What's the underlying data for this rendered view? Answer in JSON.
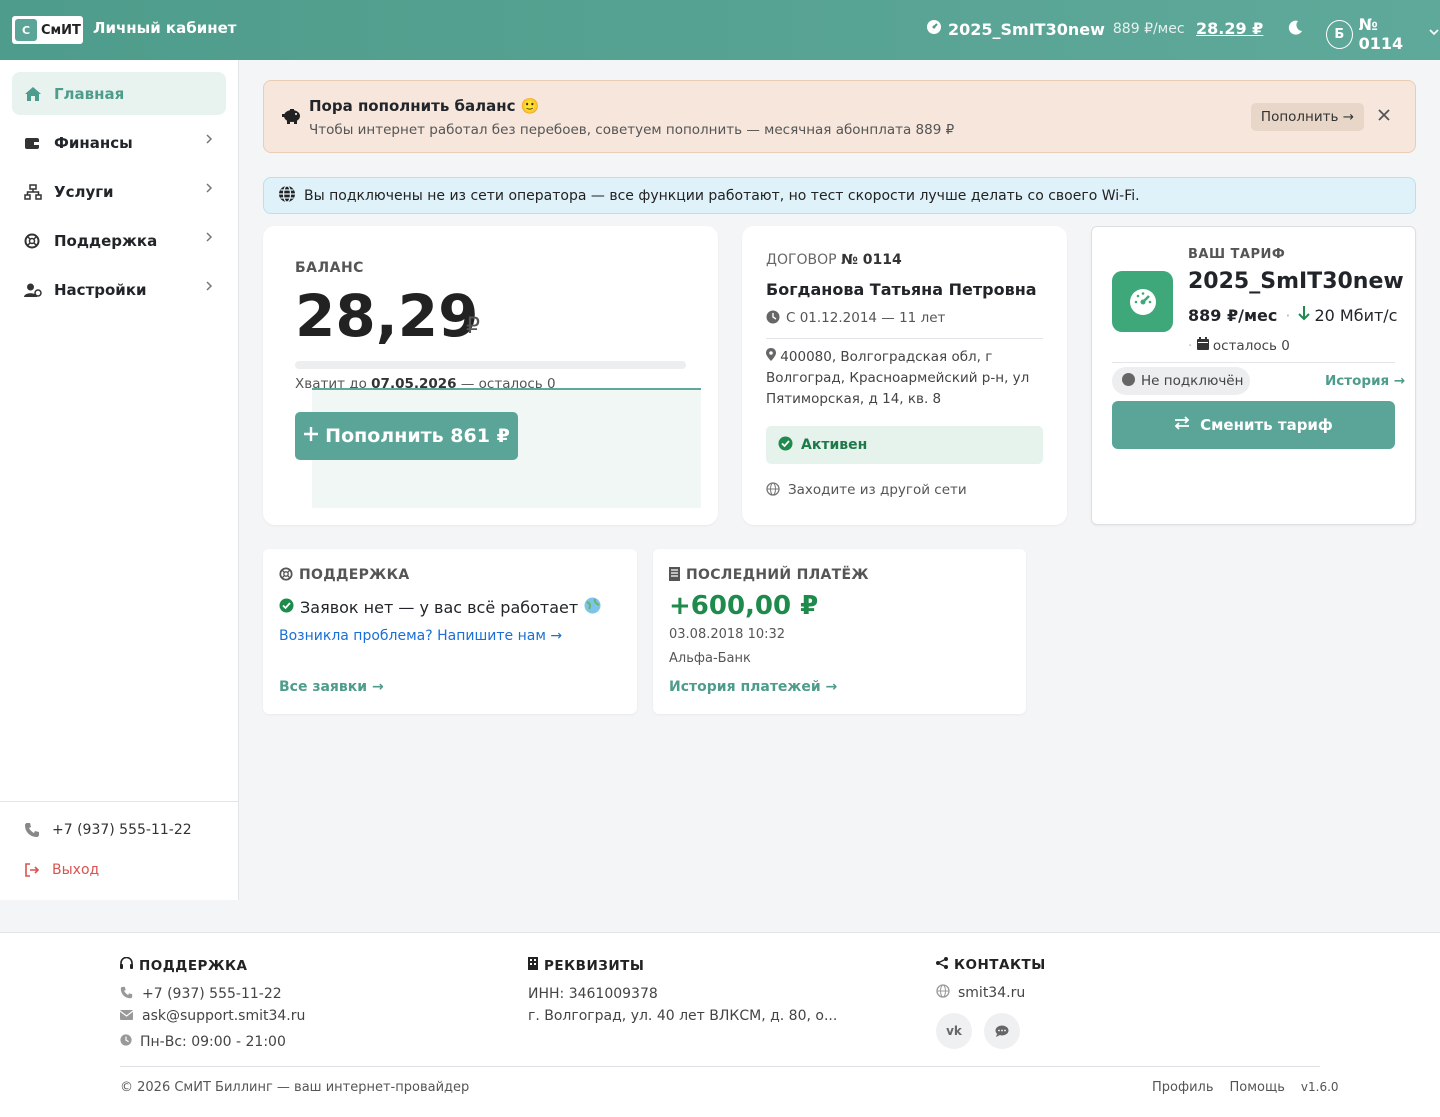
{
  "header": {
    "logo_letter": "С",
    "logo_text": "СмИТ",
    "title": "Личный кабинет",
    "tariff_name": "2025_SmIT30new",
    "tariff_price": "889 ₽/мес",
    "balance": "28.29 ₽",
    "avatar_letter": "Б",
    "contract": "№ 0114"
  },
  "sidebar": {
    "items": [
      {
        "label": "Главная",
        "icon": "home-icon"
      },
      {
        "label": "Финансы",
        "icon": "wallet-icon"
      },
      {
        "label": "Услуги",
        "icon": "network-icon"
      },
      {
        "label": "Поддержка",
        "icon": "lifebuoy-icon"
      },
      {
        "label": "Настройки",
        "icon": "user-settings-icon"
      }
    ],
    "phone": "+7 (937) 555-11-22",
    "logout": "Выход"
  },
  "alert_warn": {
    "title": "Пора пополнить баланс 🙂",
    "text": "Чтобы интернет работал без перебоев, советуем пополнить — месячная абонплата 889 ₽",
    "button": "Пополнить →"
  },
  "alert_info": {
    "text": "Вы подключены не из сети оператора — все функции работают, но тест скорости лучше делать со своего Wi-Fi."
  },
  "balance_card": {
    "label": "БАЛАНС",
    "amount": "28,29",
    "currency": "₽",
    "note_prefix": "Хватит до ",
    "note_date": "07.05.2026",
    "note_suffix": " — осталось 0",
    "button": "Пополнить 861 ₽",
    "fill_fraction": 0
  },
  "contract_card": {
    "label_prefix": "ДОГОВОР ",
    "label_number": "№ 0114",
    "name": "Богданова Татьяна Петровна",
    "since": "С 01.12.2014 — 11 лет",
    "address": "400080, Волгоградская обл, г Волгоград, Красноармейский р-н, ул Пятиморская, д 14, кв. 8",
    "status": "Активен",
    "network": "Заходите из другой сети"
  },
  "tariff_card": {
    "label": "ВАШ ТАРИФ",
    "name": "2025_SmIT30new",
    "price": "889 ₽/мес",
    "speed": "20 Мбит/с",
    "left": "осталось 0",
    "connection": "Не подключён",
    "history": "История →",
    "button": "Сменить тариф"
  },
  "support_card": {
    "title": "ПОДДЕРЖКА",
    "status": "Заявок нет — у вас всё работает",
    "link": "Возникла проблема? Напишите нам →",
    "all": "Все заявки →"
  },
  "payment_card": {
    "title": "ПОСЛЕДНИЙ ПЛАТЁЖ",
    "amount": "+600,00 ₽",
    "date": "03.08.2018 10:32",
    "bank": "Альфа-Банк",
    "history": "История платежей →"
  },
  "footer": {
    "support_title": "ПОДДЕРЖКА",
    "phone": "+7 (937) 555-11-22",
    "email": "ask@support.smit34.ru",
    "hours": "Пн-Вс: 09:00 - 21:00",
    "req_title": "РЕКВИЗИТЫ",
    "inn": "ИНН: 3461009378",
    "address": "г. Волгоград, ул. 40 лет ВЛКСМ, д. 80, о...",
    "contacts_title": "КОНТАКТЫ",
    "site": "smit34.ru",
    "vk": "vk",
    "copyright": "© 2026 СмИТ Биллинг — ваш интернет-провайдер",
    "profile": "Профиль",
    "help": "Помощь",
    "version": "v1.6.0"
  },
  "colors": {
    "accent": "#5aa597",
    "header": "#4e9c8b",
    "success": "#1e8a4c",
    "warn_bg": "#f6e6dc",
    "info_bg": "#dff2fa",
    "danger": "#d9534f"
  }
}
